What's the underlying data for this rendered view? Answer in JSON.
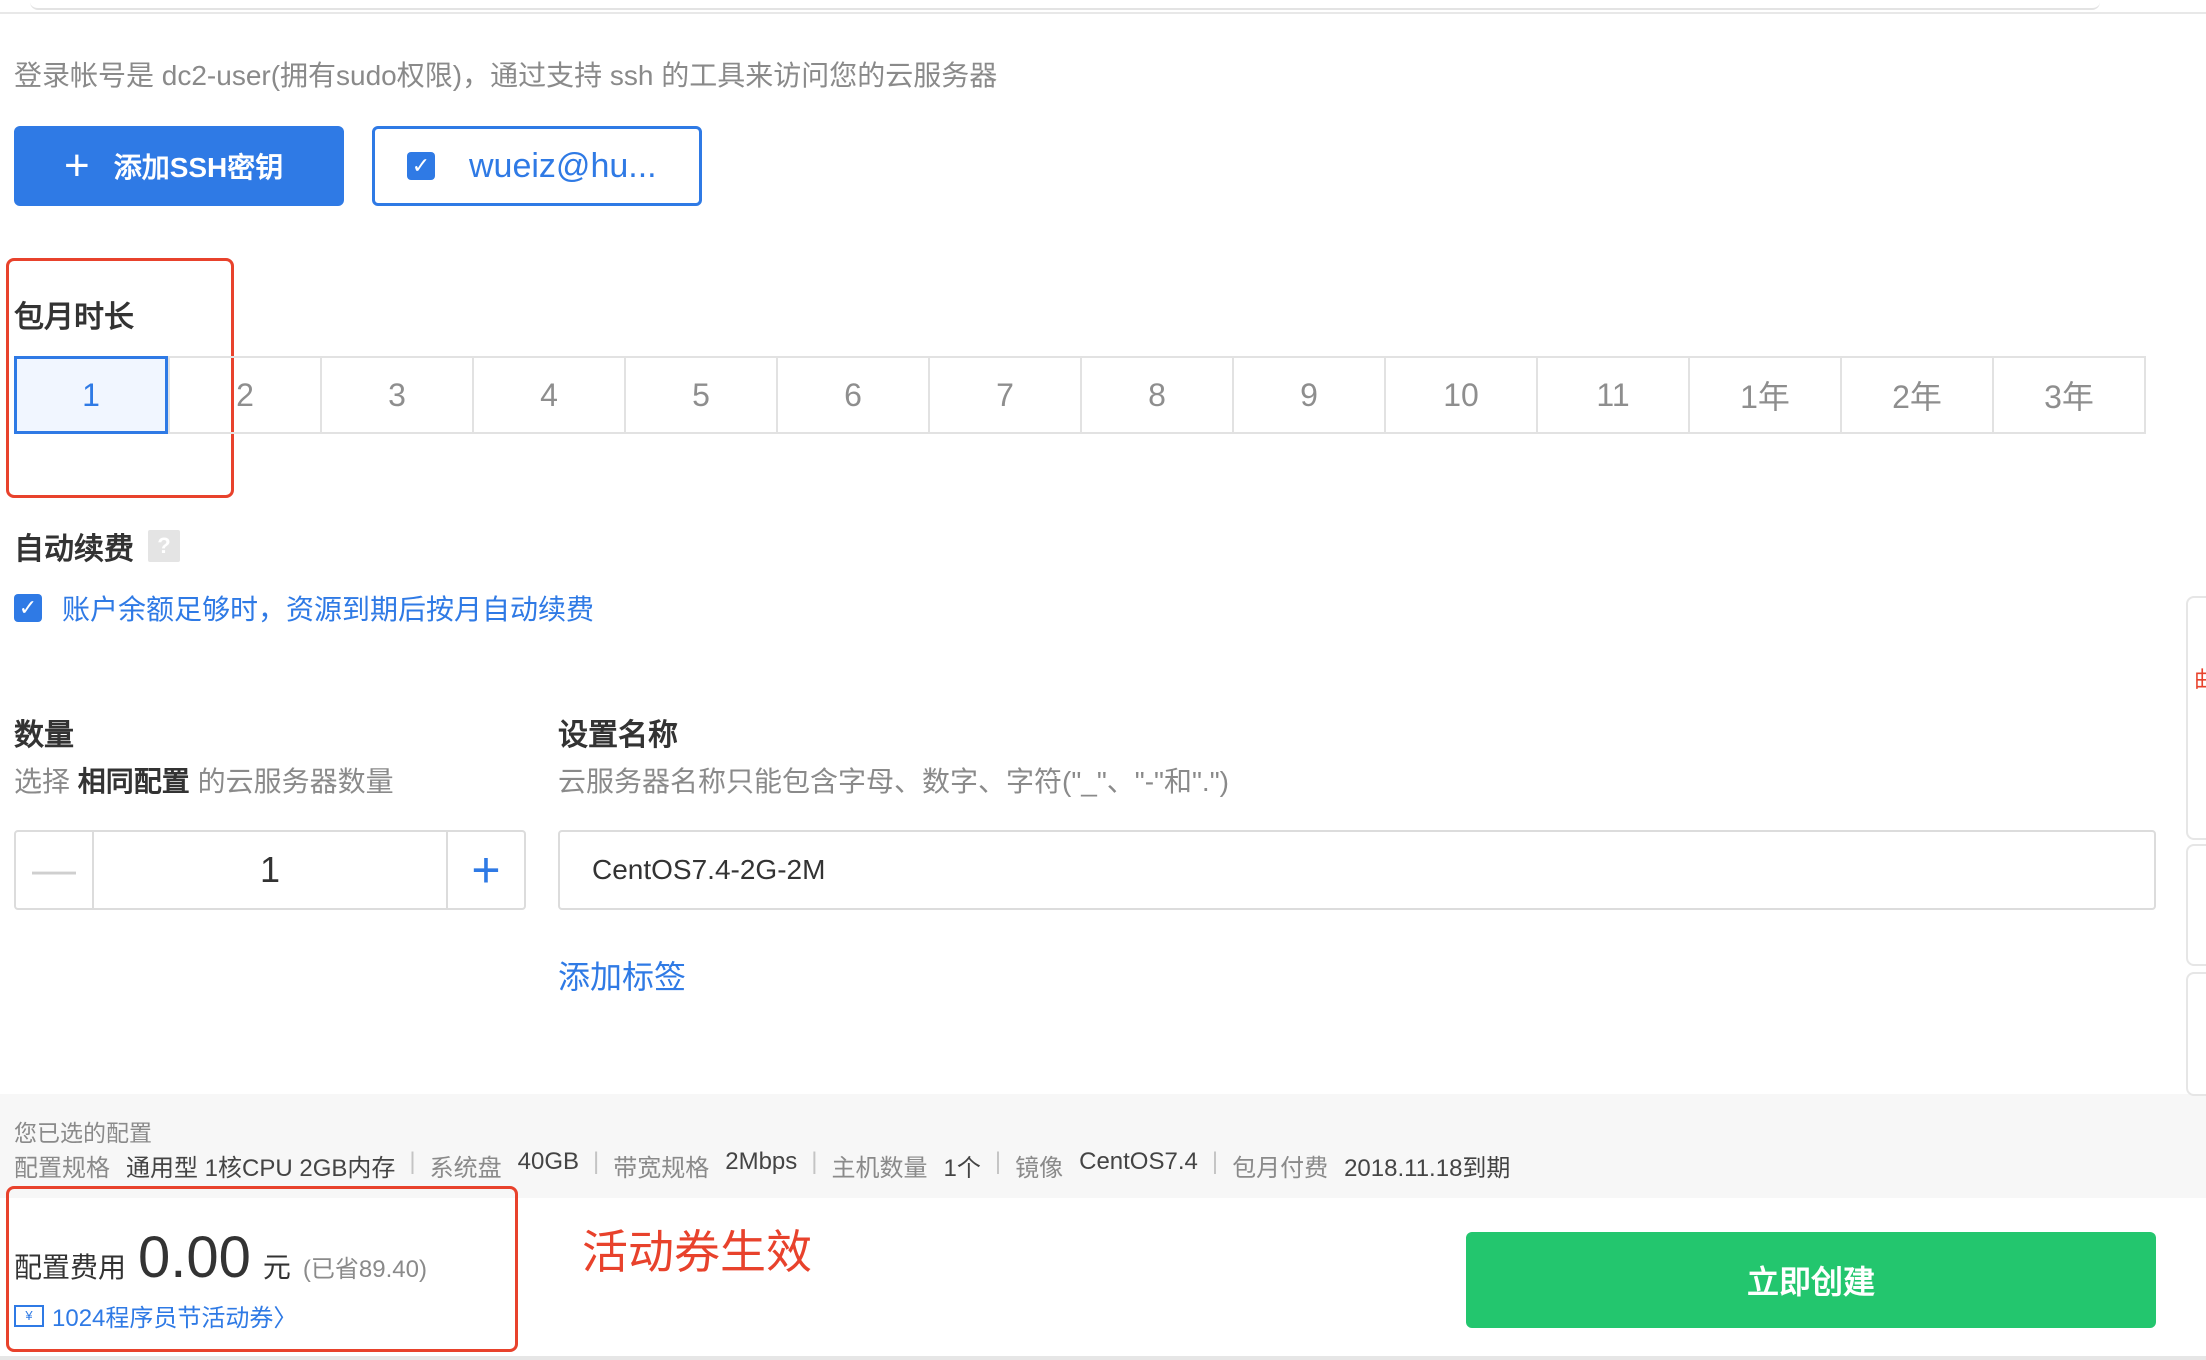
{
  "login": {
    "description": "登录帐号是 dc2-user(拥有sudo权限)，通过支持 ssh 的工具来访问您的云服务器"
  },
  "ssh": {
    "add_button_label": "添加SSH密钥",
    "key_label": "wueiz@hu..."
  },
  "month": {
    "label": "包月时长",
    "options": [
      "1",
      "2",
      "3",
      "4",
      "5",
      "6",
      "7",
      "8",
      "9",
      "10",
      "11",
      "1年",
      "2年",
      "3年"
    ],
    "selected": "1"
  },
  "auto_renew": {
    "label": "自动续费",
    "help": "?",
    "checkbox_label": "账户余额足够时，资源到期后按月自动续费",
    "checked": true
  },
  "quantity": {
    "label": "数量",
    "desc_prefix": "选择",
    "desc_bold": "相同配置",
    "desc_suffix": "的云服务器数量",
    "value": "1",
    "minus": "—",
    "plus": "+"
  },
  "name": {
    "label": "设置名称",
    "desc": "云服务器名称只能包含字母、数字、字符(\"_\"、\"-\"和\".\")",
    "value": "CentOS7.4-2G-2M",
    "add_tag": "添加标签"
  },
  "summary": {
    "title": "您已选的配置",
    "specs": [
      {
        "k": "配置规格",
        "v": "通用型 1核CPU 2GB内存"
      },
      {
        "k": "系统盘",
        "v": "40GB"
      },
      {
        "k": "带宽规格",
        "v": "2Mbps"
      },
      {
        "k": "主机数量",
        "v": "1个"
      },
      {
        "k": "镜像",
        "v": "CentOS7.4"
      },
      {
        "k": "包月付费",
        "v": "2018.11.18到期"
      }
    ]
  },
  "fee": {
    "label": "配置费用",
    "amount": "0.00",
    "unit": "元",
    "saved": "(已省89.40)"
  },
  "coupon": {
    "icon_text": "¥",
    "label": "1024程序员节活动券",
    "chevron": "〉"
  },
  "annotation": {
    "text": "活动券生效"
  },
  "create_button": "立即创建",
  "side": {
    "glyph": "曲"
  },
  "colors": {
    "primary": "#2f7ae5",
    "success": "#23c66e",
    "annotation": "#e8422c"
  }
}
